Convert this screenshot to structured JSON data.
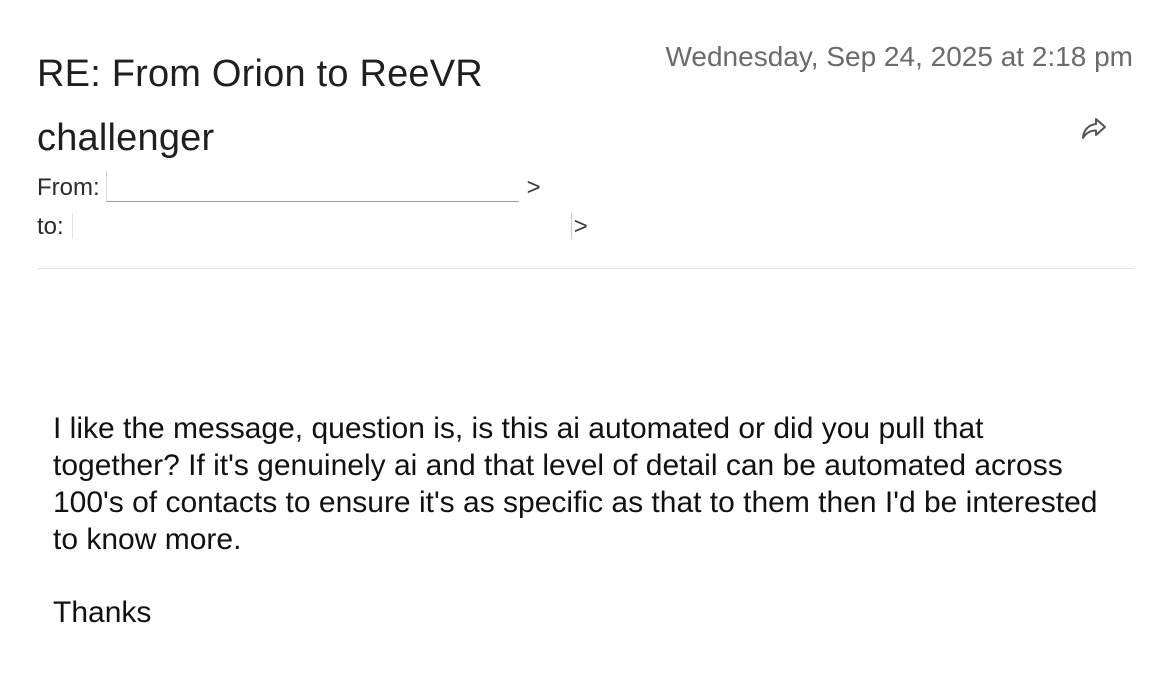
{
  "email": {
    "subject": "RE: From Orion to ReeVR challenger",
    "date": "Wednesday, Sep 24, 2025 at 2:18 pm",
    "from_label": "From:",
    "from_suffix": ">",
    "to_label": "to:",
    "to_suffix": ">",
    "body": "I like the message, question is, is this ai automated or did you pull that together? If it's genuinely ai and that level of detail can be automated across 100's of contacts to ensure it's as specific as that to them then I'd be interested to know more.",
    "signoff": "Thanks"
  },
  "icons": {
    "forward": "forward-arrow-icon"
  },
  "colors": {
    "text": "#1f1f1f",
    "date": "#6b6b6b",
    "divider": "#e3e3e3"
  }
}
